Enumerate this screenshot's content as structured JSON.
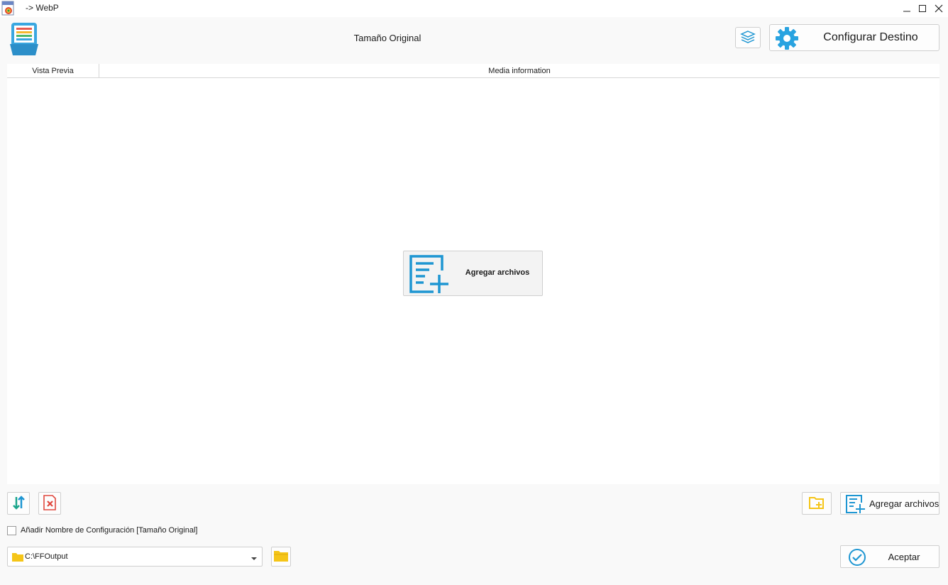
{
  "window": {
    "title": "-> WebP",
    "icon": "webp-file-icon",
    "controls": [
      "minimize-icon",
      "maximize-icon",
      "close-icon"
    ]
  },
  "header": {
    "logo_icon": "file-list-logo-icon",
    "title": "Tamaño Original",
    "layers_icon": "layers-icon",
    "config_button": {
      "label": "Configurar Destino",
      "icon": "gear-icon"
    }
  },
  "file_list": {
    "columns": [
      "Vista Previa",
      "Media information"
    ],
    "add_button": {
      "label": "Agregar archivos",
      "icon": "add-file-icon"
    }
  },
  "toolbar": {
    "sort_icon": "sort-icon",
    "clear_icon": "clear-list-icon",
    "add_folder_icon": "add-folder-icon",
    "add_files_label": "Agregar archivos"
  },
  "options": {
    "append_config_name_label": "Añadir Nombre de Configuración [Tamaño Original]",
    "append_config_name_checked": false
  },
  "output": {
    "path": "C:\\FFOutput",
    "browse_icon": "folder-icon"
  },
  "accept_button": {
    "label": "Aceptar",
    "icon": "checkmark-circle-icon"
  },
  "colors": {
    "accent_blue": "#1e96d2",
    "folder_yellow": "#f5c518",
    "clear_red": "#e0483e",
    "sort_green": "#1aa58a"
  }
}
